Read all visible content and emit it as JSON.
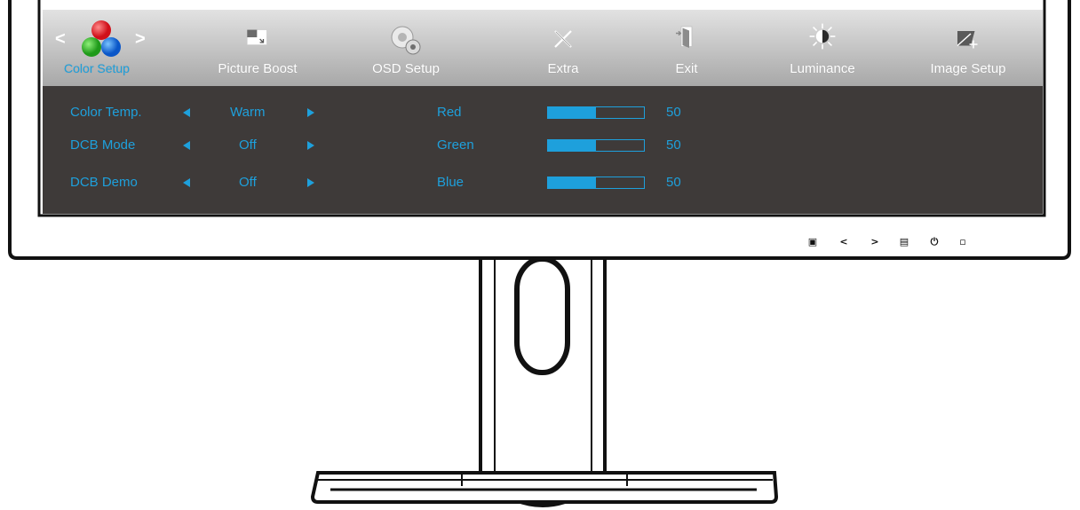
{
  "menu": {
    "items": [
      {
        "label": "Color Setup",
        "icon": "rgb-balls-icon",
        "active": true
      },
      {
        "label": "Picture Boost",
        "icon": "picture-boost-icon"
      },
      {
        "label": "OSD Setup",
        "icon": "osd-gear-icon"
      },
      {
        "label": "Extra",
        "icon": "tools-icon"
      },
      {
        "label": "Exit",
        "icon": "exit-door-icon"
      },
      {
        "label": "Luminance",
        "icon": "sun-icon"
      },
      {
        "label": "Image Setup",
        "icon": "image-setup-icon"
      }
    ],
    "nav_prev": "<",
    "nav_next": ">"
  },
  "settings": {
    "left": [
      {
        "label": "Color Temp.",
        "value": "Warm"
      },
      {
        "label": "DCB Mode",
        "value": "Off"
      },
      {
        "label": "DCB Demo",
        "value": "Off"
      }
    ],
    "right": [
      {
        "label": "Red",
        "value": "50",
        "level": 0.5
      },
      {
        "label": "Green",
        "value": "50",
        "level": 0.5
      },
      {
        "label": "Blue",
        "value": "50",
        "level": 0.5
      }
    ]
  },
  "front_buttons": [
    {
      "glyph": "▣",
      "icon": "source-icon"
    },
    {
      "glyph": "<",
      "icon": "left-key-icon"
    },
    {
      "glyph": ">",
      "icon": "right-key-icon"
    },
    {
      "glyph": "▤",
      "icon": "menu-key-icon"
    },
    {
      "glyph": "⏻",
      "icon": "power-icon"
    },
    {
      "glyph": "▫",
      "icon": "power-led-icon"
    }
  ],
  "colors": {
    "accent": "#1ea0dc",
    "content_bg": "#3e3a39"
  }
}
